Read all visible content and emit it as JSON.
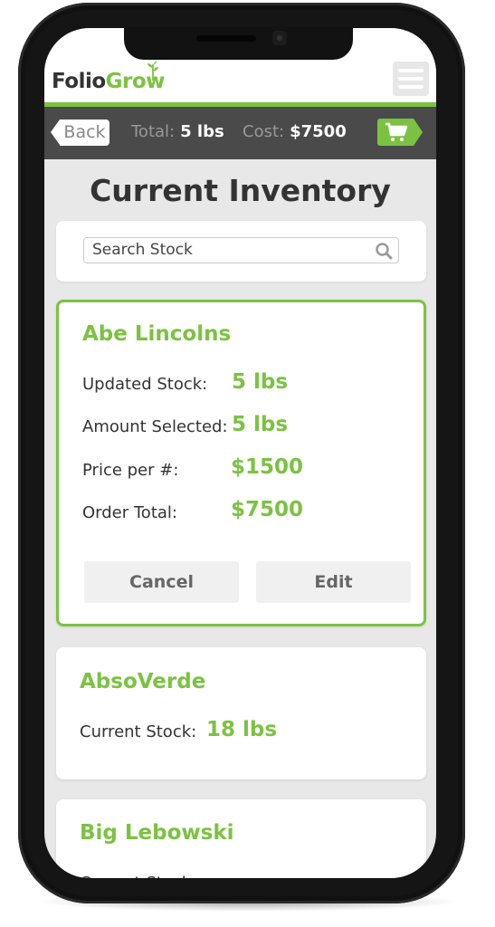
{
  "app": {
    "logo_part1": "Folio",
    "logo_part2": "Grow"
  },
  "colors": {
    "accent": "#7cc242",
    "bar": "#4a4a4a",
    "text": "#333333"
  },
  "toolbar": {
    "back_label": "Back",
    "total_label": "Total:",
    "total_value": "5 lbs",
    "cost_label": "Cost:",
    "cost_value": "$7500",
    "cart_icon": "cart-icon",
    "menu_icon": "hamburger-menu-icon"
  },
  "page": {
    "title": "Current Inventory"
  },
  "search": {
    "placeholder": "Search Stock",
    "value": ""
  },
  "inventory": [
    {
      "name": "Abe Lincolns",
      "selected": true,
      "rows": [
        {
          "label": "Updated Stock:",
          "value": "5 lbs"
        },
        {
          "label": "Amount Selected:",
          "value": "5 lbs"
        },
        {
          "label": "Price per #:",
          "value": "$1500"
        },
        {
          "label": "Order Total:",
          "value": "$7500"
        }
      ],
      "buttons": {
        "cancel": "Cancel",
        "edit": "Edit"
      }
    },
    {
      "name": "AbsoVerde",
      "rows": [
        {
          "label": "Current Stock:",
          "value": "18 lbs"
        }
      ]
    },
    {
      "name": "Big Lebowski",
      "rows": [
        {
          "label": "Current Stock:",
          "value": ""
        }
      ]
    }
  ]
}
